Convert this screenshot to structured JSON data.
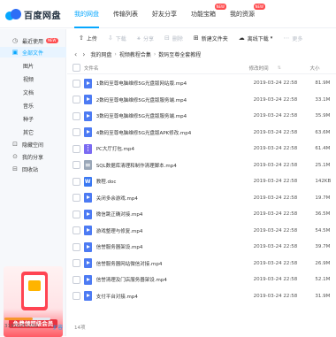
{
  "header": {
    "logo_text": "百度网盘",
    "nav": [
      {
        "label": "我的网盘",
        "active": true,
        "badge": ""
      },
      {
        "label": "传输列表",
        "active": false,
        "badge": ""
      },
      {
        "label": "好友分享",
        "active": false,
        "badge": ""
      },
      {
        "label": "功能宝箱",
        "active": false,
        "badge": "NEW"
      },
      {
        "label": "我的资源",
        "active": false,
        "badge": "NEW"
      }
    ]
  },
  "sidebar": {
    "items": [
      {
        "label": "最近使用",
        "icon": "clock-icon",
        "badge": "NEW"
      },
      {
        "label": "全部文件",
        "icon": "folder-icon",
        "active": true
      },
      {
        "label": "图片"
      },
      {
        "label": "视频"
      },
      {
        "label": "文档"
      },
      {
        "label": "音乐"
      },
      {
        "label": "种子"
      },
      {
        "label": "其它"
      },
      {
        "label": "隐藏空间",
        "icon": "lock-icon"
      },
      {
        "label": "我的分享",
        "icon": "share-icon"
      },
      {
        "label": "回收站",
        "icon": "trash-icon"
      }
    ],
    "promo_text": "免费领超级会员",
    "quota_text": "3197G/5125G",
    "quota_fraction": 0.62,
    "expand_label": "扩容"
  },
  "toolbar": {
    "upload": "上传",
    "download": "下载",
    "share": "分享",
    "delete": "删除",
    "new_folder": "新建文件夹",
    "offline_download": "离线下载",
    "more": "更多"
  },
  "breadcrumb": {
    "items": [
      "我的网盘",
      "视频教程合集",
      "数码至尊全套教程"
    ]
  },
  "table": {
    "columns": {
      "name": "文件名",
      "time": "修改时间",
      "size": "大小"
    },
    "rows": [
      {
        "icon": "video",
        "name": "1数码至尊电脑维修5G光盘版网站版.mp4",
        "time": "2019-03-24 22:58",
        "size": "81.9M"
      },
      {
        "icon": "video",
        "name": "2数码至尊电脑维修5G光盘版服务端.mp4",
        "time": "2019-03-24 22:58",
        "size": "33.1M"
      },
      {
        "icon": "video",
        "name": "3数码至尊电脑维修5G光盘版服务端.mp4",
        "time": "2019-03-24 22:58",
        "size": "35.9M"
      },
      {
        "icon": "video",
        "name": "4数码至尊电脑维修5G光盘版APK修改.mp4",
        "time": "2019-03-24 22:58",
        "size": "63.6M"
      },
      {
        "icon": "zip",
        "name": "PC大厅打包.mp4",
        "time": "2019-03-24 22:58",
        "size": "61.4M"
      },
      {
        "icon": "sql",
        "name": "SQL数据库清理和制作清理脚本.mp4",
        "time": "2019-03-24 22:58",
        "size": "25.1M"
      },
      {
        "icon": "doc",
        "name": "教程.doc",
        "time": "2019-03-24 22:58",
        "size": "142KB"
      },
      {
        "icon": "video",
        "name": "关闭多余游戏.mp4",
        "time": "2019-03-24 22:58",
        "size": "19.7M"
      },
      {
        "icon": "video",
        "name": "微信跳正确对接.mp4",
        "time": "2019-03-24 22:58",
        "size": "36.5M"
      },
      {
        "icon": "video",
        "name": "游戏整理与修复.mp4",
        "time": "2019-03-24 22:58",
        "size": "54.5M"
      },
      {
        "icon": "video",
        "name": "信誉服务器架设.mp4",
        "time": "2019-03-24 22:58",
        "size": "39.7M"
      },
      {
        "icon": "video",
        "name": "信誉服务器网站微信对接.mp4",
        "time": "2019-03-24 22:58",
        "size": "26.9M"
      },
      {
        "icon": "video",
        "name": "信誉清理及门店服务器架设.mp4",
        "time": "2019-03-24 22:58",
        "size": "52.1M"
      },
      {
        "icon": "video",
        "name": "支付平台对接.mp4",
        "time": "2019-03-24 22:58",
        "size": "31.9M"
      }
    ],
    "count_text": "14项"
  },
  "colors": {
    "accent": "#06a7ff",
    "badge": "#ff4d4f",
    "quota": "#f7962c"
  }
}
